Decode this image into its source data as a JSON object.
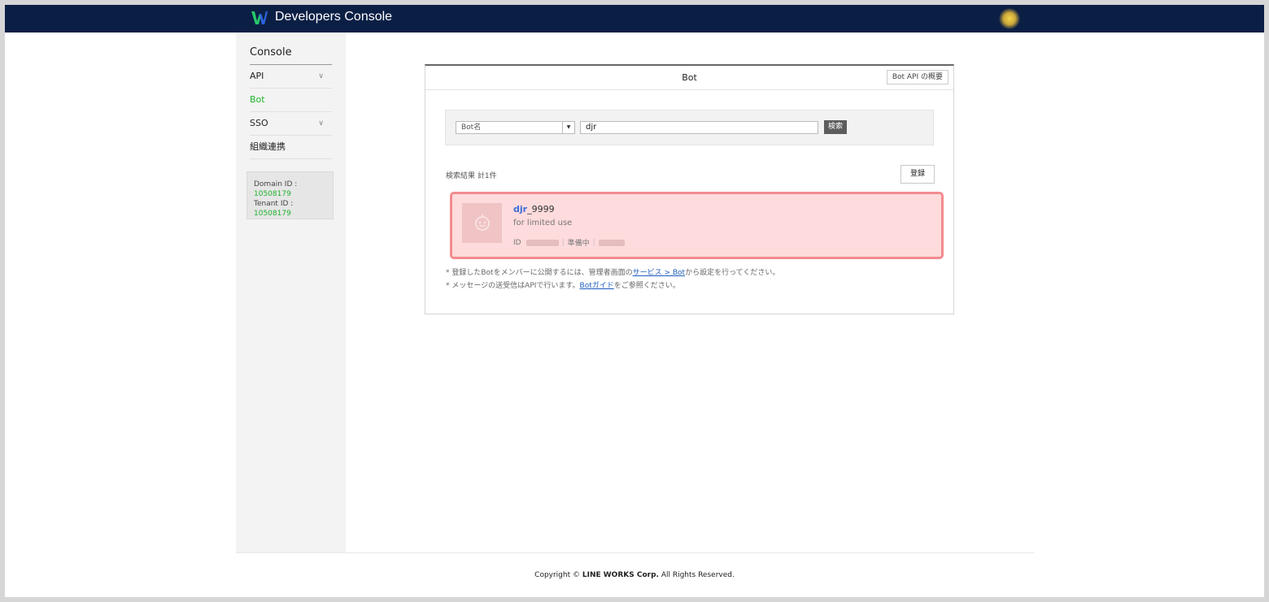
{
  "header": {
    "app_title": "Developers Console",
    "logo_icon": "line-works-logo-icon",
    "brand_colors": {
      "bar": "#0b1f45",
      "logo_green": "#27c86a",
      "logo_blue": "#2f5fe8"
    }
  },
  "sidebar": {
    "title": "Console",
    "items": [
      {
        "label": "API",
        "expandable": true
      },
      {
        "label": "Bot",
        "active": true
      },
      {
        "label": "SSO",
        "expandable": true
      },
      {
        "label": "組織連携"
      }
    ],
    "domain_label": "Domain ID :",
    "domain_id": "10508179",
    "tenant_label": "Tenant ID :",
    "tenant_id": "10508179"
  },
  "panel": {
    "title": "Bot",
    "api_button": "Bot API の概要",
    "search": {
      "select_value": "Bot名",
      "query": "djr",
      "button": "検索"
    },
    "result_count": "検索結果 計1件",
    "register_button": "登録",
    "results": [
      {
        "name_highlight": "djr",
        "name_rest": "_9999",
        "description": "for limited use",
        "id_label": "ID",
        "status": "準備中",
        "thumbnail_icon": "bot-face-icon"
      }
    ],
    "notes": [
      {
        "prefix": "* 登録したBotをメンバーに公開するには、管理者画面の",
        "link": "サービス > Bot",
        "suffix": "から設定を行ってください。"
      },
      {
        "prefix": "* メッセージの送受信はAPIで行います。",
        "link": "Botガイド",
        "suffix": "をご参照ください。"
      }
    ]
  },
  "footer": {
    "prefix": "Copyright © ",
    "company": "LINE WORKS Corp.",
    "suffix": " All Rights Reserved."
  },
  "colors": {
    "accent_green": "#1eb32e",
    "link_blue": "#1e5cc0",
    "highlight_card": "#fedbdc",
    "highlight_border": "#f28b8e"
  }
}
